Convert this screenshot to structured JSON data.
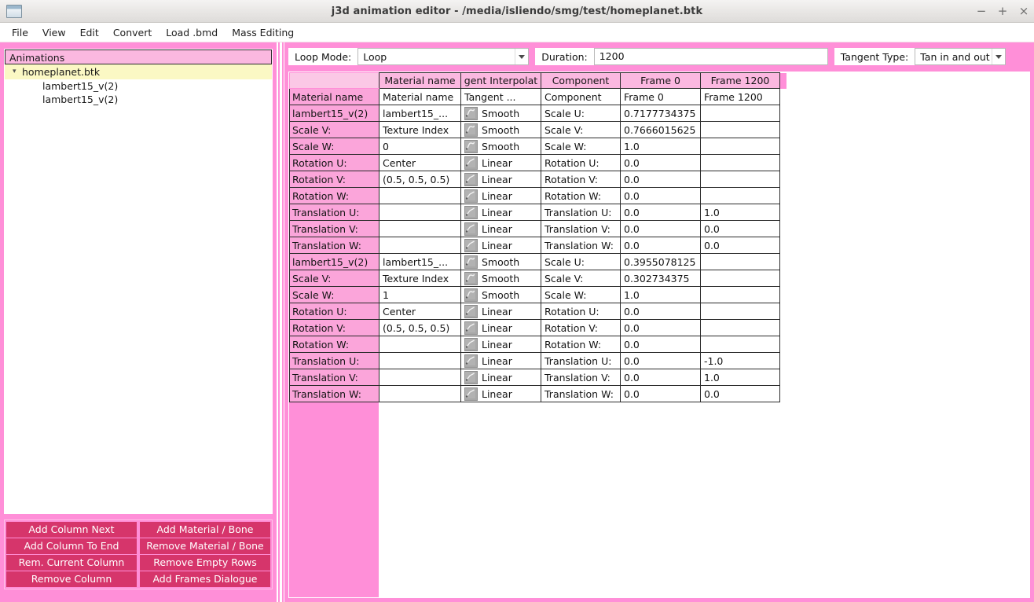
{
  "window": {
    "title": "j3d animation editor - /media/isliendo/smg/test/homeplanet.btk",
    "icon": "window-icon",
    "minimize": "−",
    "maximize": "+",
    "close": "×"
  },
  "menubar": {
    "items": [
      {
        "label": "File"
      },
      {
        "label": "View"
      },
      {
        "label": "Edit"
      },
      {
        "label": "Convert"
      },
      {
        "label": "Load .bmd"
      },
      {
        "label": "Mass Editing"
      }
    ]
  },
  "sidebar": {
    "header": "Animations",
    "tree": {
      "root": {
        "label": "homeplanet.btk",
        "expander": "▾"
      },
      "children": [
        {
          "label": "lambert15_v(2)"
        },
        {
          "label": "lambert15_v(2)"
        }
      ]
    },
    "buttons": [
      {
        "label": "Add Column Next"
      },
      {
        "label": "Add Material / Bone"
      },
      {
        "label": "Add Column To End"
      },
      {
        "label": "Remove Material / Bone"
      },
      {
        "label": "Rem. Current Column"
      },
      {
        "label": "Remove Empty Rows"
      },
      {
        "label": "Remove Column"
      },
      {
        "label": "Add Frames Dialogue"
      }
    ]
  },
  "toolbar": {
    "loop_mode_label": "Loop Mode:",
    "loop_mode_value": "Loop",
    "duration_label": "Duration:",
    "duration_value": "1200",
    "tangent_type_label": "Tangent Type:",
    "tangent_type_value": "Tan in and out"
  },
  "table": {
    "column_headers": [
      "Material name",
      "gent Interpolat",
      "Component",
      "Frame 0",
      "Frame 1200"
    ],
    "rows": [
      {
        "header": "Material name",
        "cells": [
          "Material name",
          "Tangent ...",
          "Component",
          "Frame 0",
          "Frame 1200"
        ],
        "icon": ""
      },
      {
        "header": "lambert15_v(2)",
        "cells": [
          "lambert15_...",
          "Smooth",
          "Scale U:",
          "0.7177734375",
          ""
        ],
        "icon": "curve-smooth-icon"
      },
      {
        "header": "Scale V:",
        "cells": [
          "Texture Index",
          "Smooth",
          "Scale V:",
          "0.7666015625",
          ""
        ],
        "icon": "curve-smooth-icon"
      },
      {
        "header": "Scale W:",
        "cells": [
          "0",
          "Smooth",
          "Scale W:",
          "1.0",
          ""
        ],
        "icon": "curve-smooth-icon"
      },
      {
        "header": "Rotation U:",
        "cells": [
          "Center",
          "Linear",
          "Rotation U:",
          "0.0",
          ""
        ],
        "icon": "curve-linear-icon"
      },
      {
        "header": "Rotation V:",
        "cells": [
          "(0.5, 0.5, 0.5)",
          "Linear",
          "Rotation V:",
          "0.0",
          ""
        ],
        "icon": "curve-linear-icon"
      },
      {
        "header": "Rotation W:",
        "cells": [
          "",
          "Linear",
          "Rotation W:",
          "0.0",
          ""
        ],
        "icon": "curve-linear-icon"
      },
      {
        "header": "Translation U:",
        "cells": [
          "",
          "Linear",
          "Translation U:",
          "0.0",
          "1.0"
        ],
        "icon": "curve-linear-icon"
      },
      {
        "header": "Translation V:",
        "cells": [
          "",
          "Linear",
          "Translation V:",
          "0.0",
          "0.0"
        ],
        "icon": "curve-linear-icon"
      },
      {
        "header": "Translation W:",
        "cells": [
          "",
          "Linear",
          "Translation W:",
          "0.0",
          "0.0"
        ],
        "icon": "curve-linear-icon"
      },
      {
        "header": "lambert15_v(2)",
        "cells": [
          "lambert15_...",
          "Smooth",
          "Scale U:",
          "0.3955078125",
          ""
        ],
        "icon": "curve-smooth-icon"
      },
      {
        "header": "Scale V:",
        "cells": [
          "Texture Index",
          "Smooth",
          "Scale V:",
          "0.302734375",
          ""
        ],
        "icon": "curve-smooth-icon"
      },
      {
        "header": "Scale W:",
        "cells": [
          "1",
          "Smooth",
          "Scale W:",
          "1.0",
          ""
        ],
        "icon": "curve-smooth-icon"
      },
      {
        "header": "Rotation U:",
        "cells": [
          "Center",
          "Linear",
          "Rotation U:",
          "0.0",
          ""
        ],
        "icon": "curve-linear-icon"
      },
      {
        "header": "Rotation V:",
        "cells": [
          "(0.5, 0.5, 0.5)",
          "Linear",
          "Rotation V:",
          "0.0",
          ""
        ],
        "icon": "curve-linear-icon"
      },
      {
        "header": "Rotation W:",
        "cells": [
          "",
          "Linear",
          "Rotation W:",
          "0.0",
          ""
        ],
        "icon": "curve-linear-icon"
      },
      {
        "header": "Translation U:",
        "cells": [
          "",
          "Linear",
          "Translation U:",
          "0.0",
          "-1.0"
        ],
        "icon": "curve-linear-icon"
      },
      {
        "header": "Translation V:",
        "cells": [
          "",
          "Linear",
          "Translation V:",
          "0.0",
          "1.0"
        ],
        "icon": "curve-linear-icon"
      },
      {
        "header": "Translation W:",
        "cells": [
          "",
          "Linear",
          "Translation W:",
          "0.0",
          "0.0"
        ],
        "icon": "curve-linear-icon"
      }
    ]
  },
  "colors": {
    "panel_pink": "#ff8fd8",
    "header_pink": "#fbb8e0",
    "row_header_pink": "#fba5da",
    "button_crimson": "#d6356b",
    "selection_yellow": "#fbf8c4"
  }
}
